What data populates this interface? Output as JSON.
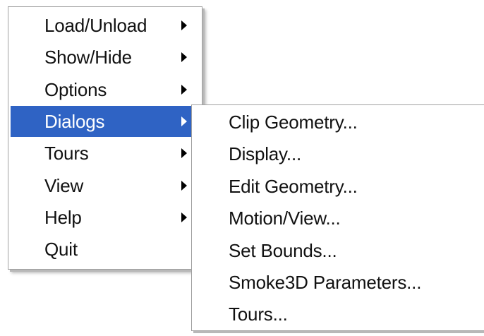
{
  "main_menu": {
    "items": [
      {
        "label": "Load/Unload",
        "has_submenu": true
      },
      {
        "label": "Show/Hide",
        "has_submenu": true
      },
      {
        "label": "Options",
        "has_submenu": true
      },
      {
        "label": "Dialogs",
        "has_submenu": true,
        "highlighted": true
      },
      {
        "label": "Tours",
        "has_submenu": true
      },
      {
        "label": "View",
        "has_submenu": true
      },
      {
        "label": "Help",
        "has_submenu": true
      },
      {
        "label": "Quit",
        "has_submenu": false
      }
    ]
  },
  "sub_menu": {
    "parent": "Dialogs",
    "items": [
      {
        "label": "Clip Geometry..."
      },
      {
        "label": "Display..."
      },
      {
        "label": "Edit Geometry..."
      },
      {
        "label": "Motion/View..."
      },
      {
        "label": "Set Bounds..."
      },
      {
        "label": "Smoke3D Parameters..."
      },
      {
        "label": "Tours..."
      }
    ]
  },
  "colors": {
    "highlight": "#2f63c4",
    "menu_background": "#ffffff",
    "text": "#111111",
    "highlight_text": "#ffffff"
  }
}
